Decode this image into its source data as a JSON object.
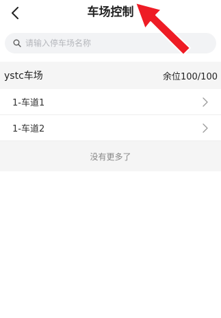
{
  "header": {
    "title": "车场控制",
    "back_icon": "back-arrow-icon"
  },
  "search": {
    "placeholder": "请输入停车场名称",
    "value": "",
    "icon": "search-icon"
  },
  "parking_lot": {
    "name": "ystc车场",
    "remaining": "余位100/100"
  },
  "lanes": [
    {
      "label": "1-车道1"
    },
    {
      "label": "1-车道2"
    }
  ],
  "footer": {
    "no_more_text": "没有更多了"
  },
  "colors": {
    "title": "#222222",
    "search_bg": "#f2f3f5",
    "section_bg": "#f5f5f5",
    "annotation_arrow": "#ee1c25"
  }
}
